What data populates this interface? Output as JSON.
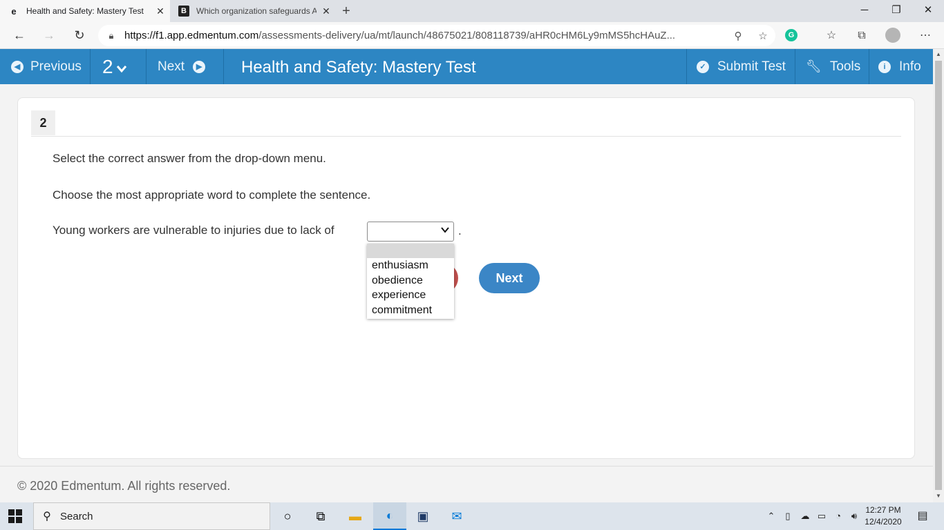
{
  "browser": {
    "tabs": [
      {
        "title": "Health and Safety: Mastery Test",
        "favicon": "e"
      },
      {
        "title": "Which organization safeguards A",
        "favicon": "B"
      }
    ],
    "url_domain": "https://f1.app.edmentum.com",
    "url_path": "/assessments-delivery/ua/mt/launch/48675021/808118739/aHR0cHM6Ly9mMS5hcHAuZ..."
  },
  "app_header": {
    "previous_label": "Previous",
    "question_number": "2",
    "next_label": "Next",
    "title": "Health and Safety: Mastery Test",
    "submit_label": "Submit Test",
    "tools_label": "Tools",
    "info_label": "Info",
    "color": "#2d86c3"
  },
  "question": {
    "number": "2",
    "instruction": "Select the correct answer from the drop-down menu.",
    "prompt": "Choose the most appropriate word to complete the sentence.",
    "sentence_start": "Young workers are vulnerable to injuries due to lack of",
    "sentence_end": ".",
    "selected_value": "",
    "options": [
      "",
      "enthusiasm",
      "obedience",
      "experience",
      "commitment"
    ]
  },
  "nav_buttons": {
    "next_label": "Next"
  },
  "footer": {
    "copyright": "© 2020 Edmentum. All rights reserved."
  },
  "taskbar": {
    "search_label": "Search",
    "time": "12:27 PM",
    "date": "12/4/2020"
  }
}
